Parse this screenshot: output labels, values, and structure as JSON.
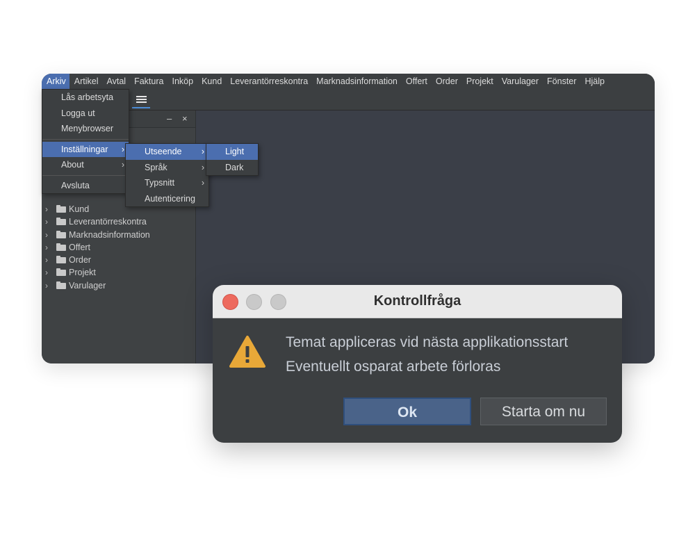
{
  "menubar": {
    "items": [
      {
        "label": "Arkiv",
        "active": true
      },
      {
        "label": "Artikel"
      },
      {
        "label": "Avtal"
      },
      {
        "label": "Faktura"
      },
      {
        "label": "Inköp"
      },
      {
        "label": "Kund"
      },
      {
        "label": "Leverantörreskontra"
      },
      {
        "label": "Marknadsinformation"
      },
      {
        "label": "Offert"
      },
      {
        "label": "Order"
      },
      {
        "label": "Projekt"
      },
      {
        "label": "Varulager"
      },
      {
        "label": "Fönster"
      },
      {
        "label": "Hjälp"
      }
    ]
  },
  "panel": {
    "minimize_icon": "–",
    "close_icon": "×"
  },
  "tree": {
    "items": [
      {
        "label": "Kund",
        "icon": "folder-icon"
      },
      {
        "label": "Leverantörreskontra",
        "icon": "folder-icon"
      },
      {
        "label": "Marknadsinformation",
        "icon": "folder-icon"
      },
      {
        "label": "Offert",
        "icon": "folder-icon"
      },
      {
        "label": "Order",
        "icon": "folder-icon"
      },
      {
        "label": "Projekt",
        "icon": "folder-icon"
      },
      {
        "label": "Varulager",
        "icon": "folder-icon"
      }
    ]
  },
  "arkiv_menu": {
    "items": [
      {
        "label": "Lås arbetsyta"
      },
      {
        "label": "Logga ut"
      },
      {
        "label": "Menybrowser"
      },
      {
        "label": "Inställningar",
        "submenu": true,
        "selected": true
      },
      {
        "label": "About",
        "submenu": true
      },
      {
        "label": "Avsluta"
      }
    ]
  },
  "installningar_menu": {
    "items": [
      {
        "label": "Utseende",
        "submenu": true,
        "selected": true
      },
      {
        "label": "Språk",
        "submenu": true
      },
      {
        "label": "Typsnitt",
        "submenu": true
      },
      {
        "label": "Autenticering"
      }
    ]
  },
  "utseende_menu": {
    "items": [
      {
        "label": "Light",
        "selected": true
      },
      {
        "label": "Dark"
      }
    ]
  },
  "dialog": {
    "title": "Kontrollfråga",
    "message_line1": "Temat appliceras vid nästa applikationsstart",
    "message_line2": "Eventuellt osparat arbete förloras",
    "ok_label": "Ok",
    "restart_label": "Starta om nu",
    "icon": "warning-icon"
  },
  "colors": {
    "accent": "#4b6eaf",
    "warning": "#e8a838",
    "close_light": "#ed6a5e"
  }
}
